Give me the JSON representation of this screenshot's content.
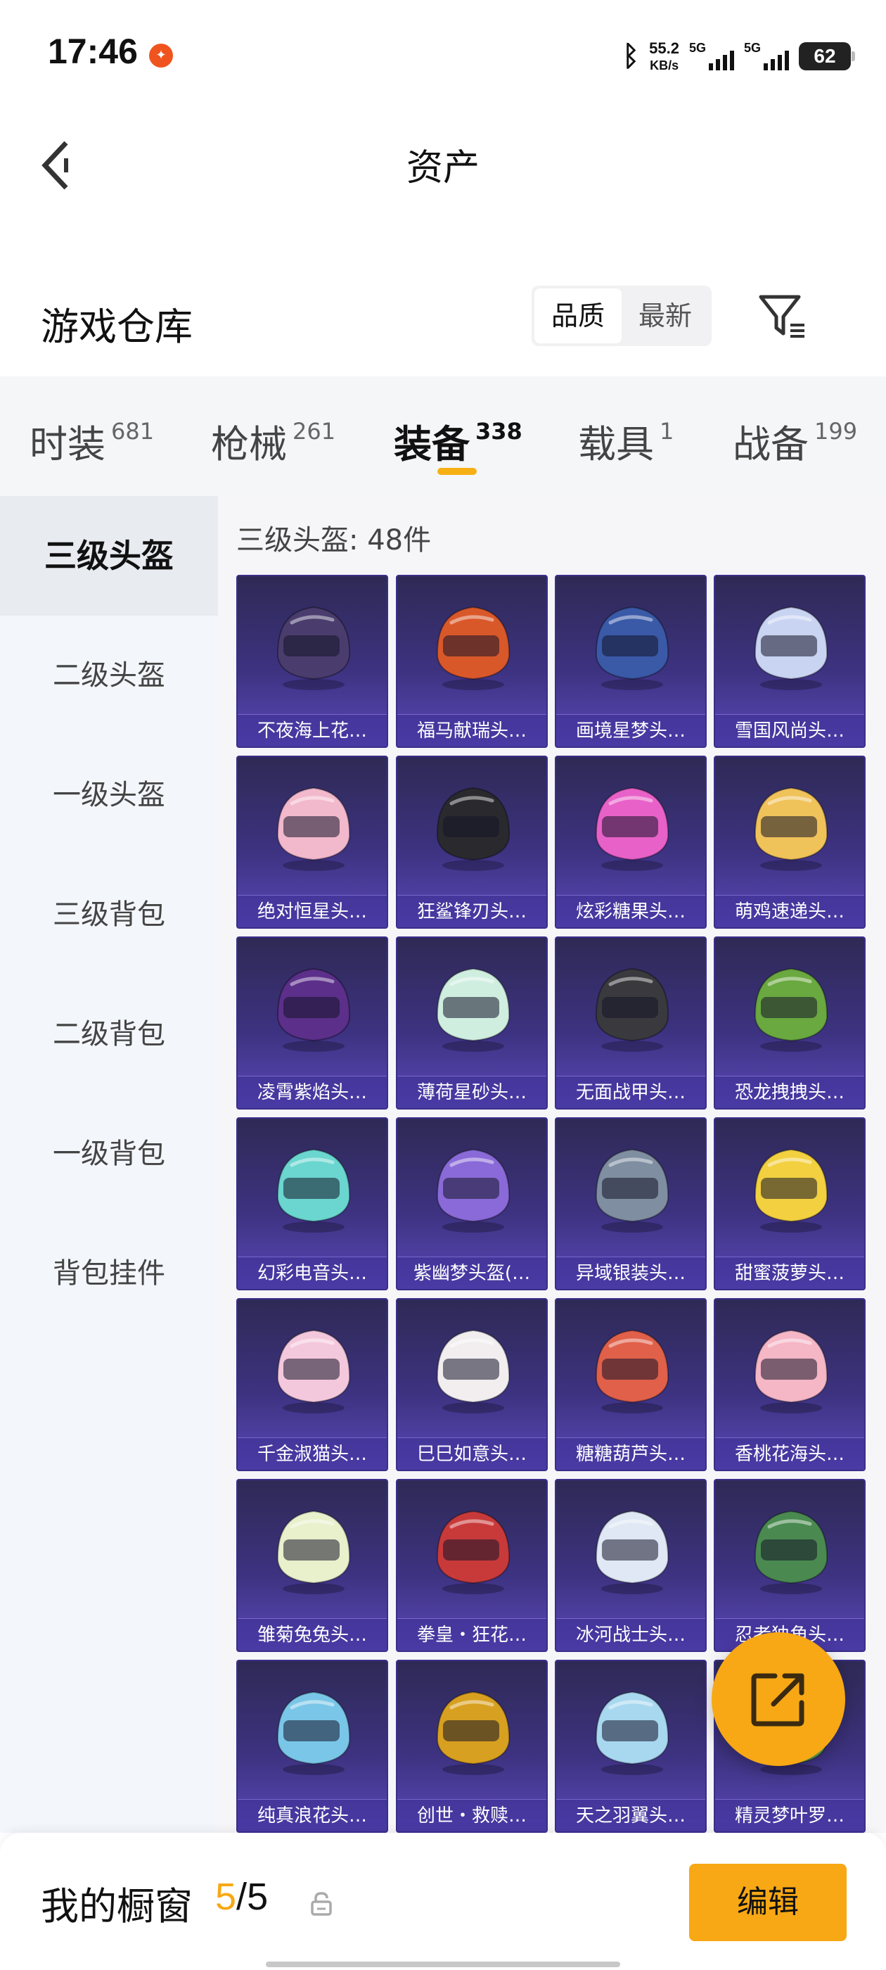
{
  "status_bar": {
    "time": "17:46",
    "notification_icon": "app-notification-icon",
    "bluetooth_icon": "bluetooth-icon",
    "net_speed_value": "55.2",
    "net_speed_unit": "KB/s",
    "signal1_label": "5G",
    "signal2_label": "5G",
    "battery": "62"
  },
  "header": {
    "back_icon": "back-arrow-icon",
    "title": "资产"
  },
  "warehouse": {
    "title": "游戏仓库",
    "sort_options": [
      "品质",
      "最新"
    ],
    "active_sort": "品质",
    "filter_icon": "filter-icon"
  },
  "categories": [
    {
      "label": "时装",
      "count": "681"
    },
    {
      "label": "枪械",
      "count": "261"
    },
    {
      "label": "装备",
      "count": "338"
    },
    {
      "label": "载具",
      "count": "1"
    },
    {
      "label": "战备",
      "count": "199"
    }
  ],
  "active_category": "装备",
  "sidebar": {
    "items": [
      "三级头盔",
      "二级头盔",
      "一级头盔",
      "三级背包",
      "二级背包",
      "一级背包",
      "背包挂件"
    ],
    "active": "三级头盔"
  },
  "content": {
    "count_label": "三级头盔: 48件",
    "items": [
      {
        "name": "不夜海上花…",
        "color": "#4a3d6e"
      },
      {
        "name": "福马献瑞头…",
        "color": "#d9582a"
      },
      {
        "name": "画境星梦头…",
        "color": "#3a5aa8"
      },
      {
        "name": "雪国风尚头…",
        "color": "#c9d4f2"
      },
      {
        "name": "绝对恒星头…",
        "color": "#f2b8cc"
      },
      {
        "name": "狂鲨锋刃头…",
        "color": "#2a2a2e"
      },
      {
        "name": "炫彩糖果头…",
        "color": "#e861c8"
      },
      {
        "name": "萌鸡速递头…",
        "color": "#f0c25a"
      },
      {
        "name": "凌霄紫焰头…",
        "color": "#5b2f8a"
      },
      {
        "name": "薄荷星砂头…",
        "color": "#cfeee0"
      },
      {
        "name": "无面战甲头…",
        "color": "#3a3a3e"
      },
      {
        "name": "恐龙拽拽头…",
        "color": "#6aa840"
      },
      {
        "name": "幻彩电音头…",
        "color": "#6ad6cf"
      },
      {
        "name": "紫幽梦头盔(…",
        "color": "#8a6ad8"
      },
      {
        "name": "异域银装头…",
        "color": "#7f8ea0"
      },
      {
        "name": "甜蜜菠萝头…",
        "color": "#f2d040"
      },
      {
        "name": "千金淑猫头…",
        "color": "#f4c8dc"
      },
      {
        "name": "巳巳如意头…",
        "color": "#f2eef0"
      },
      {
        "name": "糖糖葫芦头…",
        "color": "#e0604a"
      },
      {
        "name": "香桃花海头…",
        "color": "#f5b6c6"
      },
      {
        "name": "雏菊兔兔头…",
        "color": "#e8f0cc"
      },
      {
        "name": "拳皇・狂花…",
        "color": "#c83a3a"
      },
      {
        "name": "冰河战士头…",
        "color": "#dfe8f4"
      },
      {
        "name": "忍者独角头…",
        "color": "#4a8a50"
      },
      {
        "name": "纯真浪花头…",
        "color": "#7ac6e8"
      },
      {
        "name": "创世・救赎…",
        "color": "#d8a020"
      },
      {
        "name": "天之羽翼头…",
        "color": "#a8d8f0"
      },
      {
        "name": "精灵梦叶罗…",
        "color": "#6aa850"
      }
    ]
  },
  "share_button_icon": "share-external-icon",
  "bottom_bar": {
    "showcase_label": "我的橱窗",
    "showcase_current": "5",
    "showcase_sep": "/",
    "showcase_total": "5",
    "lock_icon": "lock-icon",
    "edit_label": "编辑"
  },
  "colors": {
    "accent": "#f7b014",
    "item_bg_top": "#2e2a55",
    "item_bg_bottom": "#5a48b8"
  }
}
